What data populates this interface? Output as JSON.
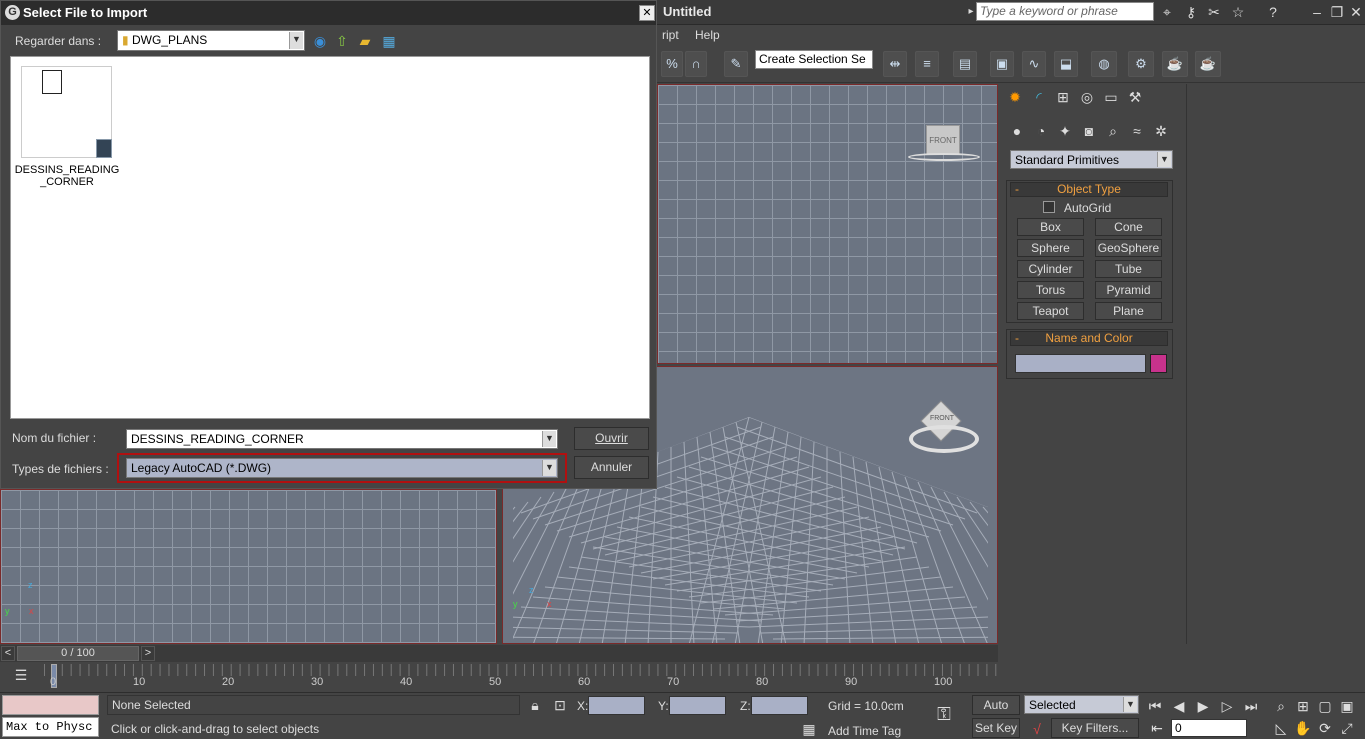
{
  "app": {
    "title": "Untitled",
    "search_placeholder": "Type a keyword or phrase",
    "menus": [
      "ript",
      "Help"
    ],
    "selection_set": "Create Selection Se"
  },
  "command_panel": {
    "category": "Standard Primitives",
    "object_type": {
      "header": "Object Type",
      "autogrid": "AutoGrid",
      "buttons": [
        "Box",
        "Cone",
        "Sphere",
        "GeoSphere",
        "Cylinder",
        "Tube",
        "Torus",
        "Pyramid",
        "Teapot",
        "Plane"
      ]
    },
    "name_color": {
      "header": "Name and Color",
      "color": "#c8328c"
    }
  },
  "viewports": {
    "top_right_cube": "FRONT",
    "persp_cube": "FRONT",
    "axis": {
      "x": "x",
      "y": "y",
      "z": "z"
    }
  },
  "timeline": {
    "frame": "0 / 100",
    "prev": "<",
    "next": ">",
    "ticks": [
      "0",
      "10",
      "20",
      "30",
      "40",
      "50",
      "60",
      "70",
      "80",
      "90",
      "100"
    ]
  },
  "status": {
    "listener": "Max to Physc",
    "selection": "None Selected",
    "prompt": "Click or click-and-drag to select objects",
    "x_label": "X:",
    "y_label": "Y:",
    "z_label": "Z:",
    "grid": "Grid = 10.0cm",
    "add_time_tag": "Add Time Tag",
    "auto_key": "Auto Key",
    "set_key": "Set Key",
    "selected": "Selected",
    "key_filters": "Key Filters...",
    "frame_value": "0"
  },
  "dialog": {
    "title": "Select File to Import",
    "look_in_label": "Regarder dans :",
    "look_in_value": "DWG_PLANS",
    "file_item": "DESSINS_READING_CORNER",
    "filename_label": "Nom du fichier :",
    "filename_value": "DESSINS_READING_CORNER",
    "filetype_label": "Types de fichiers :",
    "filetype_value": "Legacy AutoCAD (*.DWG)",
    "open_button": "Ouvrir",
    "cancel_button": "Annuler"
  }
}
